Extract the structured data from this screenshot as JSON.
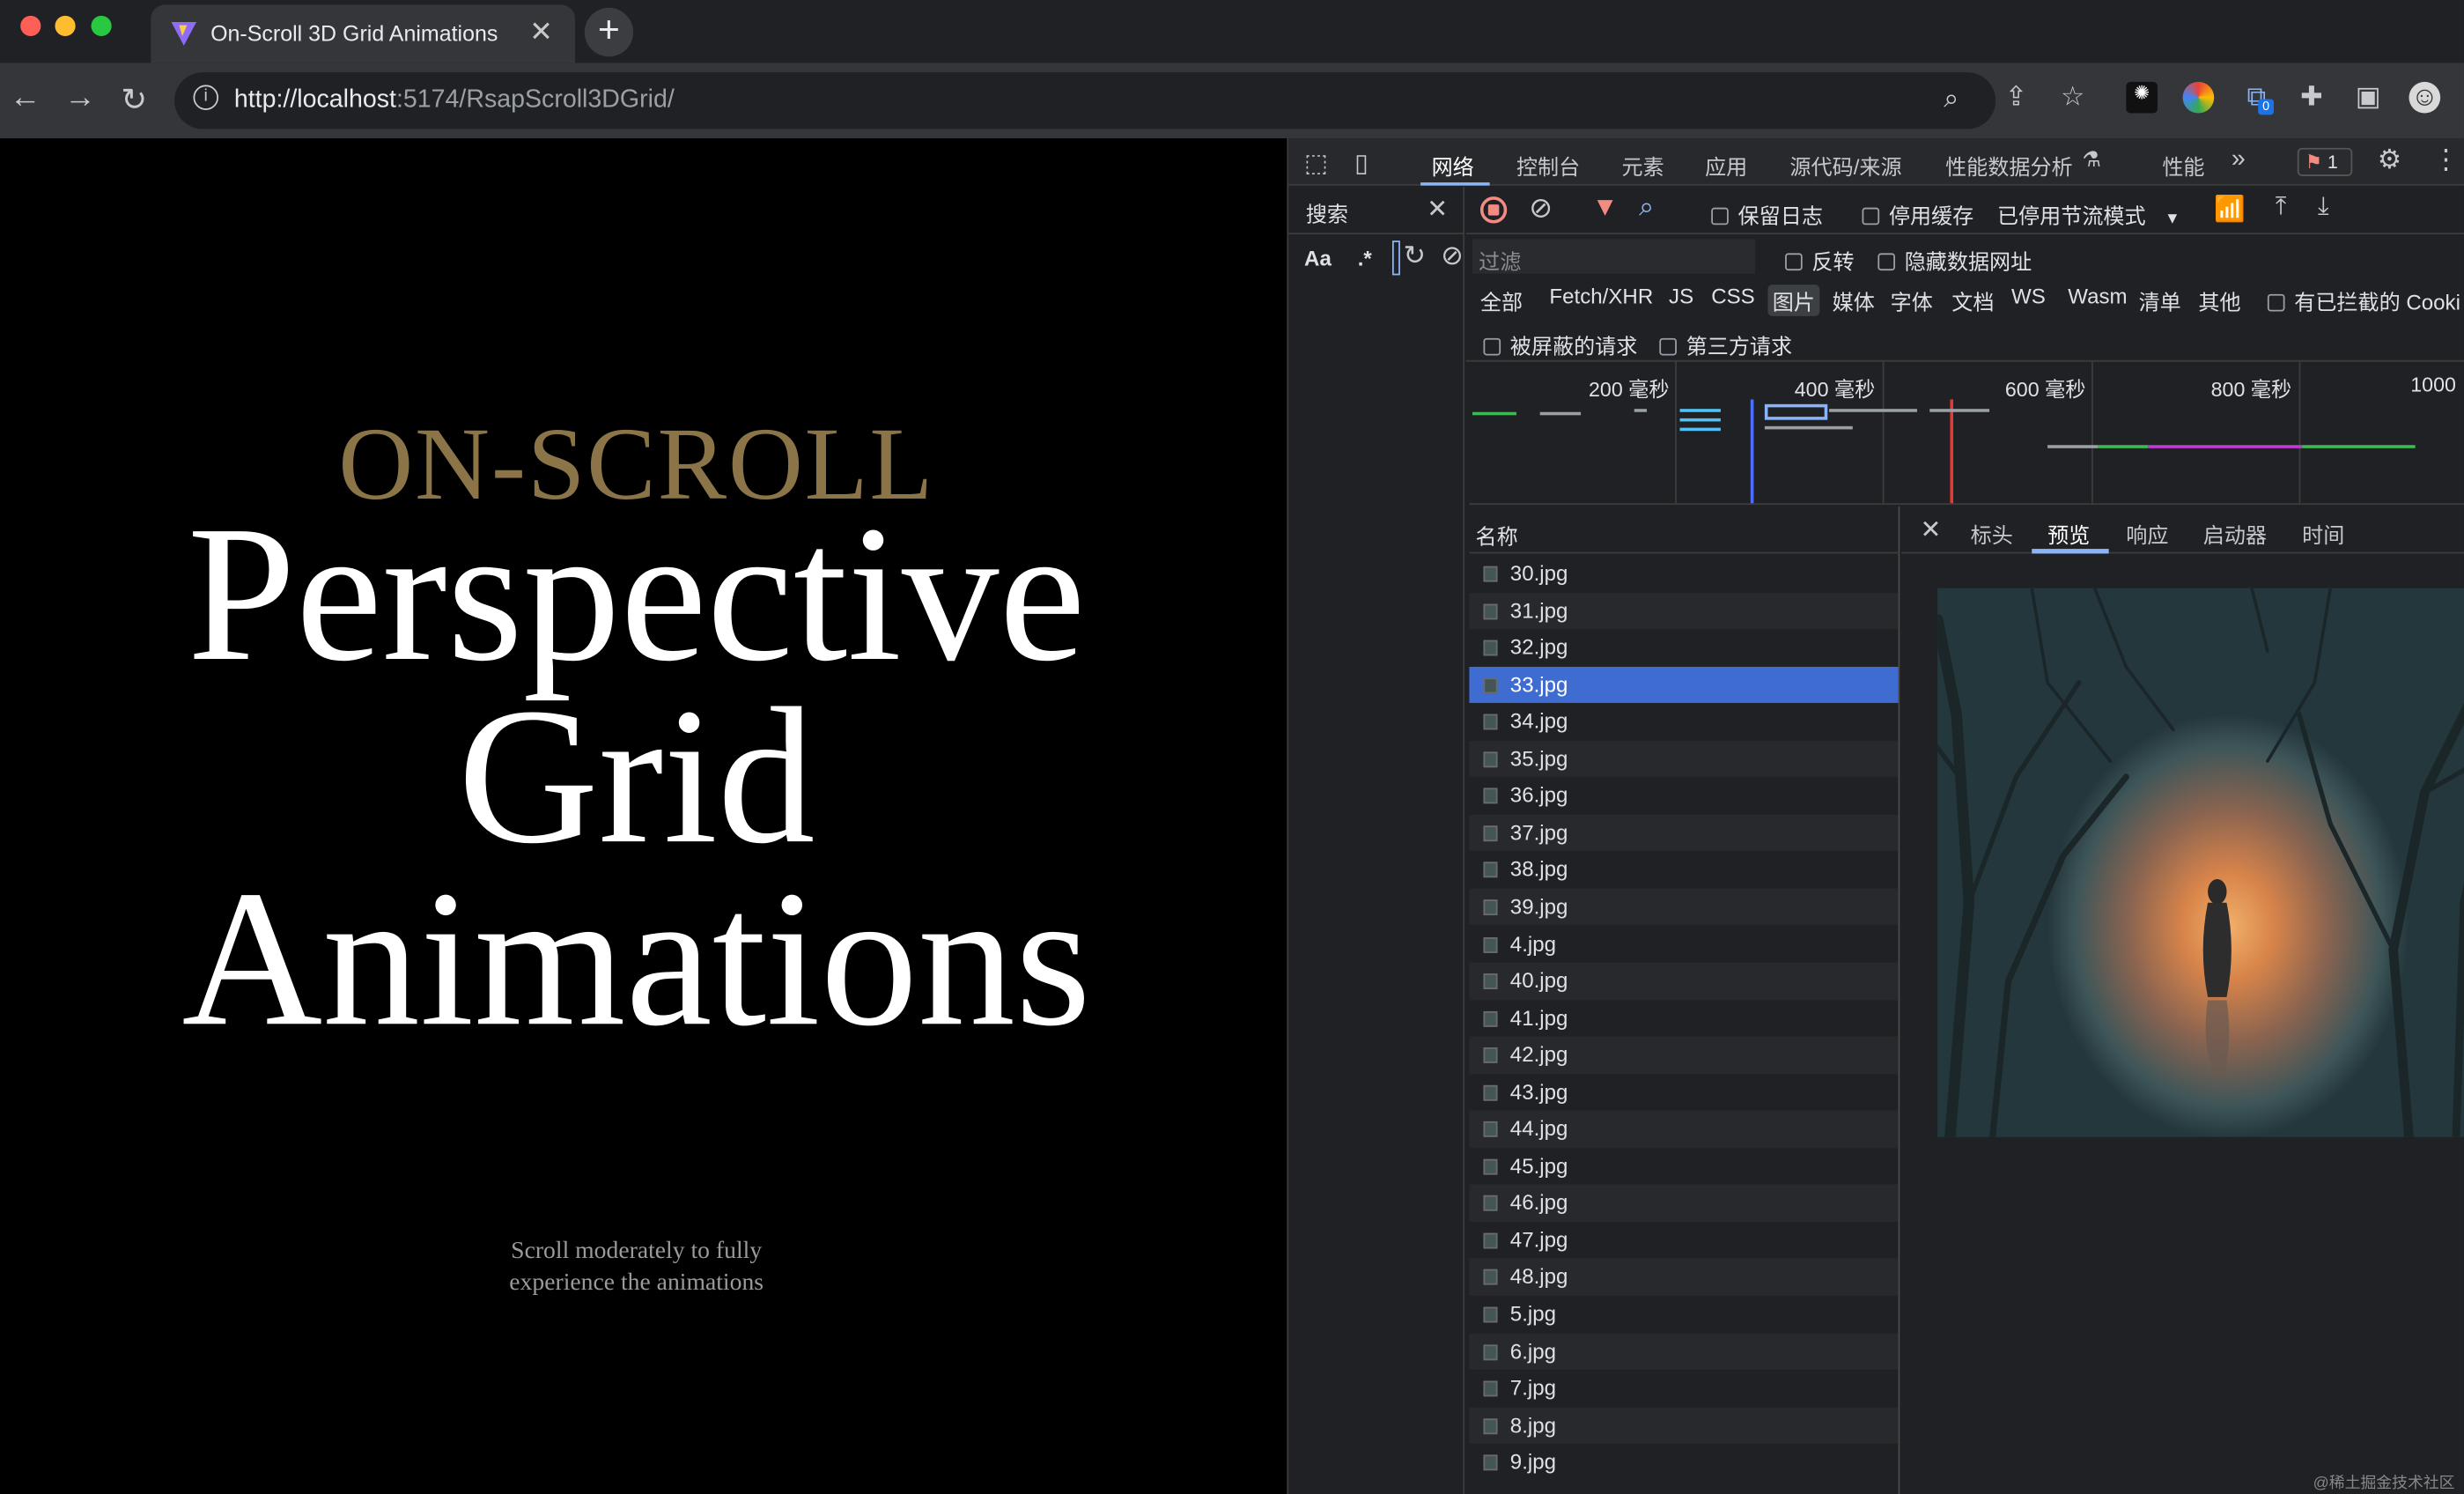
{
  "browser": {
    "tab_title": "On-Scroll 3D Grid Animations",
    "url_host": "http://localhost",
    "url_rest": ":5174/RsapScroll3DGrid/",
    "extension_badge": "0"
  },
  "page": {
    "kicker": "ON-SCROLL",
    "headline_1": "Perspective",
    "headline_2": "Grid",
    "headline_3": "Animations",
    "hint": "Scroll moderately to fully experience the animations",
    "kicker_color": "#8b7548"
  },
  "devtools": {
    "tabs": [
      "网络",
      "控制台",
      "元素",
      "应用",
      "源代码/来源",
      "性能数据分析",
      "性能"
    ],
    "issues_count": "1",
    "search_label": "搜索",
    "search_case": "Aa",
    "search_regex": ".*",
    "preserve_log": "保留日志",
    "disable_cache": "停用缓存",
    "throttle": "已停用节流模式",
    "filter_placeholder": "过滤",
    "invert": "反转",
    "hide_data_urls": "隐藏数据网址",
    "types": [
      "全部",
      "Fetch/XHR",
      "JS",
      "CSS",
      "图片",
      "媒体",
      "字体",
      "文档",
      "WS",
      "Wasm",
      "清单",
      "其他"
    ],
    "blocked_cookies": "有已拦截的 Cooki",
    "blocked_requests": "被屏蔽的请求",
    "third_party": "第三方请求",
    "ticks": [
      "200 毫秒",
      "400 毫秒",
      "600 毫秒",
      "800 毫秒",
      "1000"
    ],
    "name_header": "名称",
    "files": [
      "30.jpg",
      "31.jpg",
      "32.jpg",
      "33.jpg",
      "34.jpg",
      "35.jpg",
      "36.jpg",
      "37.jpg",
      "38.jpg",
      "39.jpg",
      "4.jpg",
      "40.jpg",
      "41.jpg",
      "42.jpg",
      "43.jpg",
      "44.jpg",
      "45.jpg",
      "46.jpg",
      "47.jpg",
      "48.jpg",
      "5.jpg",
      "6.jpg",
      "7.jpg",
      "8.jpg",
      "9.jpg"
    ],
    "selected_file": "33.jpg",
    "preview_tabs": [
      "标头",
      "预览",
      "响应",
      "启动器",
      "时间"
    ],
    "active_preview_tab": "预览"
  },
  "watermark": "@稀土掘金技术社区"
}
